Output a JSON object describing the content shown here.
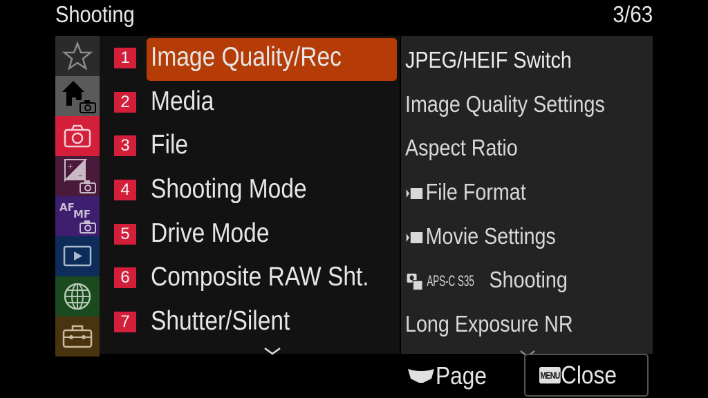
{
  "header": {
    "title": "Shooting",
    "page_indicator": "3/63"
  },
  "sidebar": {
    "tabs": [
      {
        "name": "favorites",
        "icon": "star-icon",
        "color": "#2b2b2b"
      },
      {
        "name": "main",
        "icon": "home-camera-icon",
        "color": "#5a5a5a",
        "active": true
      },
      {
        "name": "shooting",
        "icon": "camera-icon",
        "color": "#d41f3b"
      },
      {
        "name": "exposure-color",
        "icon": "exposure-camera-icon",
        "color": "#4a1a3a"
      },
      {
        "name": "focus",
        "icon": "af-mf-camera-icon",
        "color": "#3e1e6e"
      },
      {
        "name": "playback",
        "icon": "playback-icon",
        "color": "#0e2c5a"
      },
      {
        "name": "network",
        "icon": "globe-icon",
        "color": "#1a4a1e"
      },
      {
        "name": "setup",
        "icon": "toolbox-icon",
        "color": "#4a3410"
      }
    ]
  },
  "menu": {
    "selected_index": 0,
    "items": [
      {
        "number": "1",
        "label": "Image Quality/Rec"
      },
      {
        "number": "2",
        "label": "Media"
      },
      {
        "number": "3",
        "label": "File"
      },
      {
        "number": "4",
        "label": "Shooting Mode"
      },
      {
        "number": "5",
        "label": "Drive Mode"
      },
      {
        "number": "6",
        "label": "Composite RAW Sht."
      },
      {
        "number": "7",
        "label": "Shutter/Silent"
      }
    ]
  },
  "submenu": {
    "items": [
      {
        "label": "JPEG/HEIF Switch",
        "icon": null
      },
      {
        "label": "Image Quality Settings",
        "icon": null
      },
      {
        "label": "Aspect Ratio",
        "icon": null
      },
      {
        "label": "File Format",
        "icon": "movie-mode-icon"
      },
      {
        "label": "Movie Settings",
        "icon": "movie-mode-icon"
      },
      {
        "label": "Shooting",
        "icon": "still-movie-icon",
        "prefix": "APS-C S35"
      },
      {
        "label": "Long Exposure NR",
        "icon": null
      }
    ]
  },
  "footer": {
    "page_label": "Page",
    "close_badge": "MENU",
    "close_label": "Close"
  },
  "colors": {
    "accent_selected": "#b53c06",
    "number_badge": "#d41f3b"
  }
}
